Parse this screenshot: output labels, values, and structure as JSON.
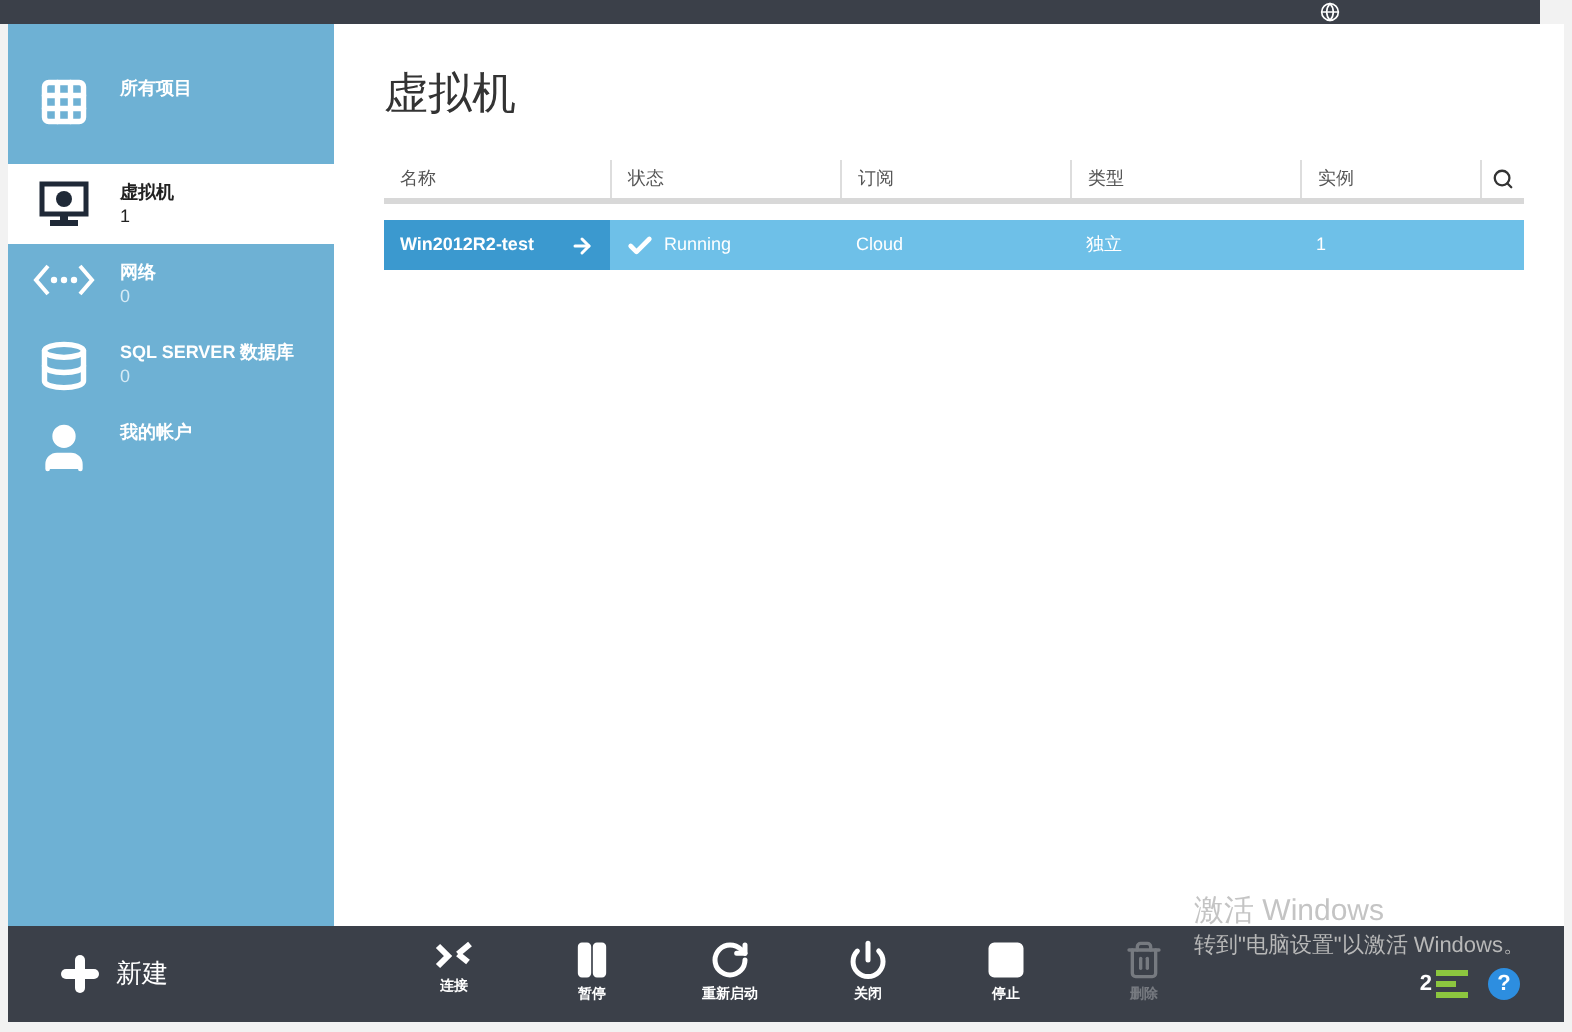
{
  "nav": [
    {
      "kind": "grid",
      "label": "所有项目",
      "selected": false
    },
    {
      "kind": "monitor",
      "label": "虚拟机",
      "count": "1",
      "selected": true
    },
    {
      "kind": "network",
      "label": "网络",
      "count": "0",
      "selected": false
    },
    {
      "kind": "database",
      "label": "SQL SERVER 数据库",
      "count": "0",
      "selected": false
    },
    {
      "kind": "user",
      "label": "我的帐户",
      "selected": false
    }
  ],
  "page_title": "虚拟机",
  "table": {
    "columns": [
      "名称",
      "状态",
      "订阅",
      "类型",
      "实例"
    ],
    "rows": [
      {
        "name": "Win2012R2-test",
        "status": "Running",
        "subscription": "Cloud",
        "type": "独立",
        "instances": "1",
        "selected": true
      }
    ]
  },
  "new_button": "新建",
  "actions": [
    {
      "kind": "connect",
      "label": "连接",
      "disabled": false
    },
    {
      "kind": "pause",
      "label": "暂停",
      "disabled": false
    },
    {
      "kind": "restart",
      "label": "重新启动",
      "disabled": false
    },
    {
      "kind": "power",
      "label": "关闭",
      "disabled": false
    },
    {
      "kind": "stop",
      "label": "停止",
      "disabled": false
    },
    {
      "kind": "delete",
      "label": "删除",
      "disabled": true
    }
  ],
  "notification_count": "2",
  "help": "?",
  "activation": {
    "title": "激活 Windows",
    "message": "转到\"电脑设置\"以激活 Windows。"
  }
}
